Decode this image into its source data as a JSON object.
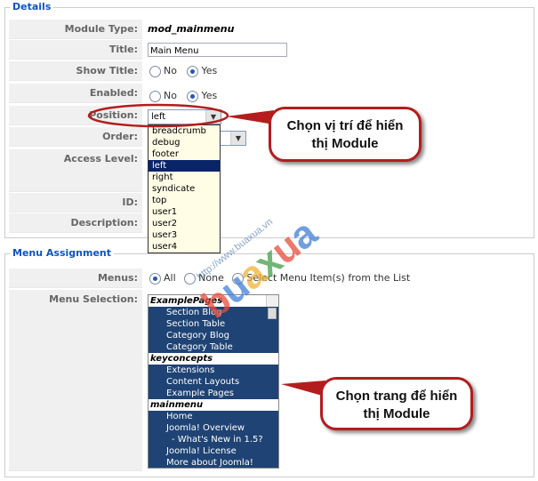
{
  "details": {
    "legend": "Details",
    "module_type": {
      "label": "Module Type:",
      "value": "mod_mainmenu"
    },
    "title": {
      "label": "Title:",
      "value": "Main Menu"
    },
    "show_title": {
      "label": "Show Title:",
      "no": "No",
      "yes": "Yes",
      "selected": "Yes"
    },
    "enabled": {
      "label": "Enabled:",
      "no": "No",
      "yes": "Yes",
      "selected": "Yes"
    },
    "position": {
      "label": "Position:",
      "value": "left",
      "options": [
        "breadcrumb",
        "debug",
        "footer",
        "left",
        "right",
        "syndicate",
        "top",
        "user1",
        "user2",
        "user3",
        "user4"
      ],
      "selected": "left"
    },
    "order": {
      "label": "Order:"
    },
    "access_level": {
      "label": "Access Level:"
    },
    "id": {
      "label": "ID:"
    },
    "description": {
      "label": "Description:"
    }
  },
  "menu_assignment": {
    "legend": "Menu Assignment",
    "menus": {
      "label": "Menus:",
      "all": "All",
      "none": "None",
      "select": "Select Menu Item(s) from the List",
      "selected": "All"
    },
    "menu_selection": {
      "label": "Menu Selection:",
      "items": [
        {
          "text": "ExamplePages",
          "group": true
        },
        {
          "text": "Section Blog",
          "indent": 1
        },
        {
          "text": "Section Table",
          "indent": 1
        },
        {
          "text": "Category Blog",
          "indent": 1
        },
        {
          "text": "Category Table",
          "indent": 1
        },
        {
          "text": "keyconcepts",
          "group": true
        },
        {
          "text": "Extensions",
          "indent": 1
        },
        {
          "text": "Content Layouts",
          "indent": 1
        },
        {
          "text": "Example Pages",
          "indent": 1
        },
        {
          "text": "mainmenu",
          "group": true
        },
        {
          "text": "Home",
          "indent": 1
        },
        {
          "text": "Joomla! Overview",
          "indent": 1
        },
        {
          "text": "- What's New in 1.5?",
          "indent": 2
        },
        {
          "text": "Joomla! License",
          "indent": 1
        },
        {
          "text": "More about Joomla!",
          "indent": 1
        }
      ]
    }
  },
  "callouts": {
    "position_note": "Chọn vị trí để hiển thị Module",
    "menu_note": "Chọn trang để hiển thị Module"
  },
  "watermark": {
    "brand": "buaxua",
    "url": "http://www.buaxua.vn",
    "colors": [
      "#e94b3c",
      "#3f7fd6",
      "#f2b233",
      "#45a049"
    ]
  },
  "accent_color": "#b31d1d"
}
